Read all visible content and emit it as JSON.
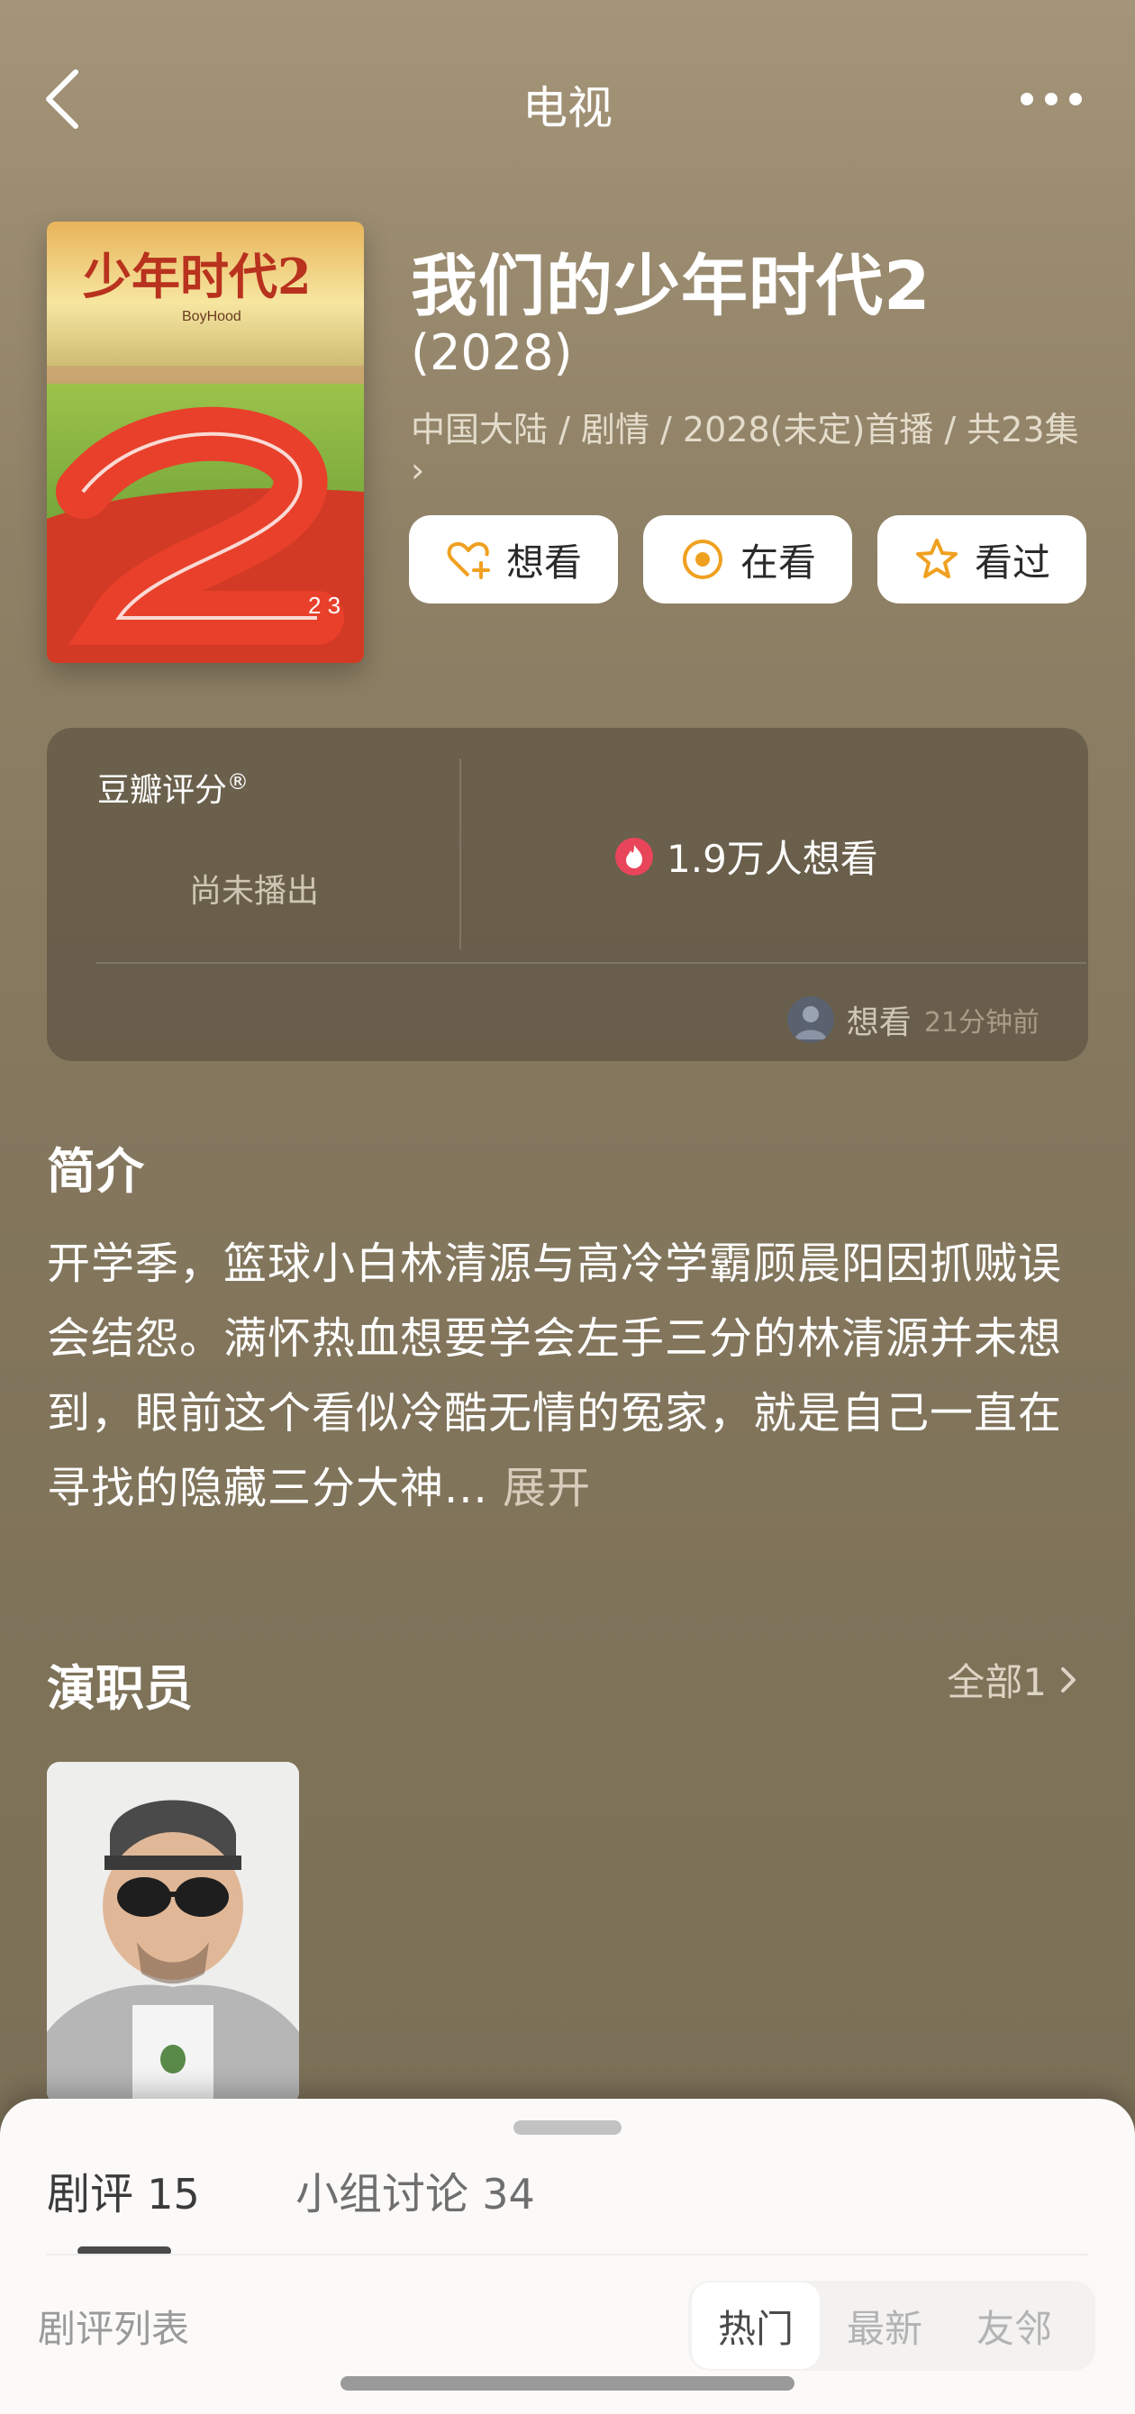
{
  "nav": {
    "title": "电视",
    "back_icon": "chevron-left-icon",
    "more_icon": "more-dots-icon"
  },
  "subject": {
    "title": "我们的少年时代2",
    "year": "(2028)",
    "meta": "中国大陆 / 剧情 / 2028(未定)首播 / 共23集",
    "meta_more": "›",
    "poster_text": "少年时代2",
    "poster_subtext": "BoyHood"
  },
  "actions": [
    {
      "label": "想看",
      "icon": "heart-plus-icon"
    },
    {
      "label": "在看",
      "icon": "target-icon"
    },
    {
      "label": "看过",
      "icon": "star-icon"
    }
  ],
  "rating": {
    "label": "豆瓣评分",
    "label_mark": "®",
    "status": "尚未播出",
    "want_count": "1.9万人想看",
    "recent_action": "想看",
    "recent_time": "21分钟前"
  },
  "intro": {
    "title": "简介",
    "text": "开学季，篮球小白林清源与高冷学霸顾晨阳因抓贼误会结怨。满怀热血想要学会左手三分的林清源并未想到，眼前这个看似冷酷无情的冤家，就是自己一直在寻找的隐藏三分大神...",
    "expand": "展开"
  },
  "cast": {
    "title": "演职员",
    "all_label": "全部1"
  },
  "sheet": {
    "tabs": [
      {
        "label": "剧评",
        "count": "15"
      },
      {
        "label": "小组讨论",
        "count": "34"
      }
    ],
    "list_title": "剧评列表",
    "sort_options": [
      "热门",
      "最新",
      "友邻"
    ]
  },
  "colors": {
    "background": "#8f8166",
    "accent_orange": "#f0a020",
    "fire_red": "#e8455a"
  }
}
